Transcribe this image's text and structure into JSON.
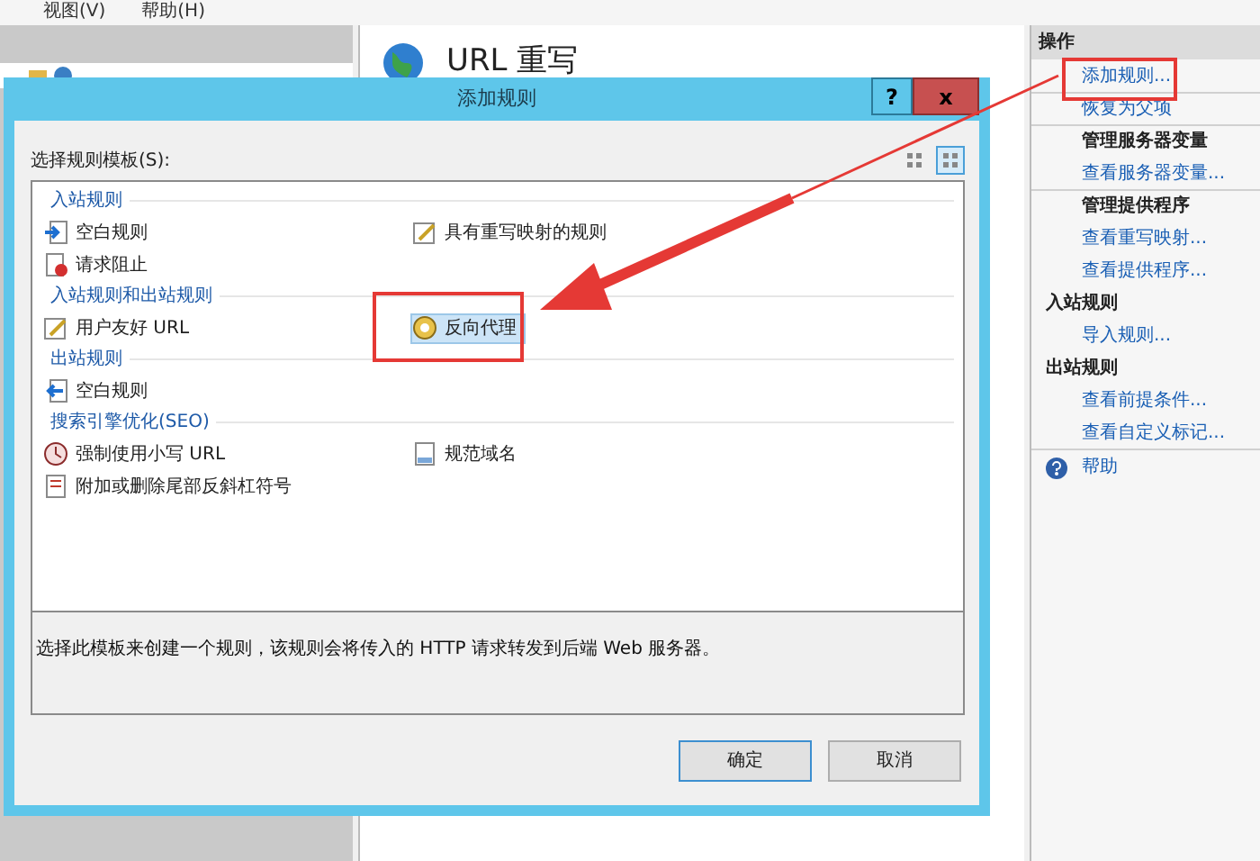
{
  "menu": [
    "视图(V)",
    "帮助(H)"
  ],
  "feature": {
    "title": "URL 重写"
  },
  "dialog": {
    "title": "添加规则",
    "help_button": "?",
    "close_button": "x",
    "template_label": "选择规则模板(S):",
    "views": [
      {
        "selected": false
      },
      {
        "selected": true
      }
    ],
    "groups": [
      {
        "title": "入站规则",
        "items": [
          {
            "label": "空白规则",
            "kind": "blankin",
            "selected": false
          },
          {
            "label": "具有重写映射的规则",
            "kind": "map",
            "selected": false
          },
          {
            "label": "请求阻止",
            "kind": "block",
            "selected": false
          }
        ]
      },
      {
        "title": "入站规则和出站规则",
        "items": [
          {
            "label": "用户友好 URL",
            "kind": "map",
            "selected": false
          },
          {
            "label": "反向代理",
            "kind": "proxy",
            "selected": true
          }
        ]
      },
      {
        "title": "出站规则",
        "items": [
          {
            "label": "空白规则",
            "kind": "blankout",
            "selected": false
          }
        ]
      },
      {
        "title": "搜索引擎优化(SEO)",
        "items": [
          {
            "label": "强制使用小写 URL",
            "kind": "lower",
            "selected": false
          },
          {
            "label": "规范域名",
            "kind": "domain",
            "selected": false
          },
          {
            "label": "附加或删除尾部反斜杠符号",
            "kind": "slash",
            "selected": false
          }
        ]
      }
    ],
    "description": "选择此模板来创建一个规则，该规则会将传入的 HTTP 请求转发到后端 Web 服务器。",
    "buttons": [
      {
        "label": "确定",
        "default": true
      },
      {
        "label": "取消",
        "default": false
      }
    ]
  },
  "actions": {
    "title": "操作",
    "items": [
      {
        "label": "添加规则...",
        "kind": "link",
        "separated": false
      },
      {
        "label": "恢复为父项",
        "kind": "link",
        "separated": true
      },
      {
        "label": "管理服务器变量",
        "kind": "heading",
        "separated": true
      },
      {
        "label": "查看服务器变量...",
        "kind": "link",
        "separated": false
      },
      {
        "label": "管理提供程序",
        "kind": "heading",
        "separated": true
      },
      {
        "label": "查看重写映射...",
        "kind": "link",
        "separated": false
      },
      {
        "label": "查看提供程序...",
        "kind": "link",
        "separated": false
      },
      {
        "label": "入站规则",
        "kind": "section",
        "separated": false
      },
      {
        "label": "导入规则...",
        "kind": "link",
        "separated": false
      },
      {
        "label": "出站规则",
        "kind": "section",
        "separated": false
      },
      {
        "label": "查看前提条件...",
        "kind": "link",
        "separated": false
      },
      {
        "label": "查看自定义标记...",
        "kind": "link",
        "separated": false
      },
      {
        "label": "帮助",
        "kind": "help",
        "separated": true
      }
    ]
  }
}
